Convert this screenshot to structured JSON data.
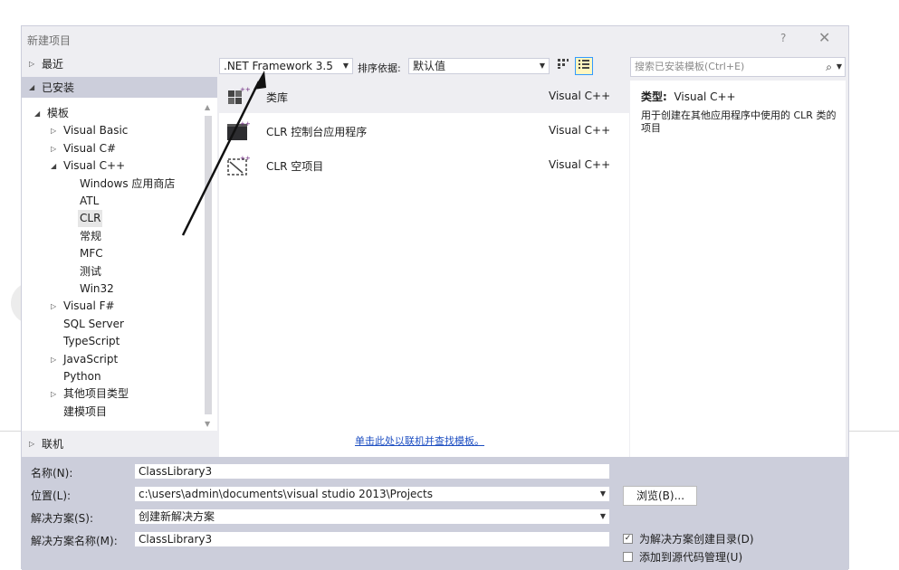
{
  "dialog": {
    "title": "新建项目",
    "help": "?",
    "close": "✕"
  },
  "left": {
    "recent": "最近",
    "installed": "已安装",
    "online": "联机",
    "tree": [
      {
        "label": "模板",
        "tri": "◢"
      },
      {
        "label": "Visual Basic",
        "tri": "▷"
      },
      {
        "label": "Visual C#",
        "tri": "▷"
      },
      {
        "label": "Visual C++",
        "tri": "◢"
      },
      {
        "label": "Windows 应用商店",
        "tri": ""
      },
      {
        "label": "ATL",
        "tri": ""
      },
      {
        "label": "CLR",
        "tri": ""
      },
      {
        "label": "常规",
        "tri": ""
      },
      {
        "label": "MFC",
        "tri": ""
      },
      {
        "label": "测试",
        "tri": ""
      },
      {
        "label": "Win32",
        "tri": ""
      },
      {
        "label": "Visual F#",
        "tri": "▷"
      },
      {
        "label": "SQL Server",
        "tri": ""
      },
      {
        "label": "TypeScript",
        "tri": ""
      },
      {
        "label": "JavaScript",
        "tri": "▷"
      },
      {
        "label": "Python",
        "tri": ""
      },
      {
        "label": "其他项目类型",
        "tri": "▷"
      },
      {
        "label": "建模项目",
        "tri": ""
      }
    ]
  },
  "toolbar": {
    "framework": ".NET Framework 3.5",
    "sort_label": "排序依据:",
    "sort_value": "默认值"
  },
  "templates": [
    {
      "name": "类库",
      "lang": "Visual C++"
    },
    {
      "name": "CLR 控制台应用程序",
      "lang": "Visual C++"
    },
    {
      "name": "CLR 空项目",
      "lang": "Visual C++"
    }
  ],
  "online_link": "单击此处以联机并查找模板。",
  "search": {
    "placeholder": "搜索已安装模板(Ctrl+E)"
  },
  "info": {
    "type_label": "类型:",
    "type_value": "Visual C++",
    "description": "用于创建在其他应用程序中使用的 CLR 类的项目"
  },
  "form": {
    "name_label": "名称(N):",
    "name_value": "ClassLibrary3",
    "location_label": "位置(L):",
    "location_value": "c:\\users\\admin\\documents\\visual studio 2013\\Projects",
    "solution_label": "解决方案(S):",
    "solution_value": "创建新解决方案",
    "solution_name_label": "解决方案名称(M):",
    "solution_name_value": "ClassLibrary3",
    "browse": "浏览(B)...",
    "create_dir_label": "为解决方案创建目录(D)",
    "create_dir_checked": true,
    "source_control_label": "添加到源代码管理(U)",
    "source_control_checked": false
  }
}
